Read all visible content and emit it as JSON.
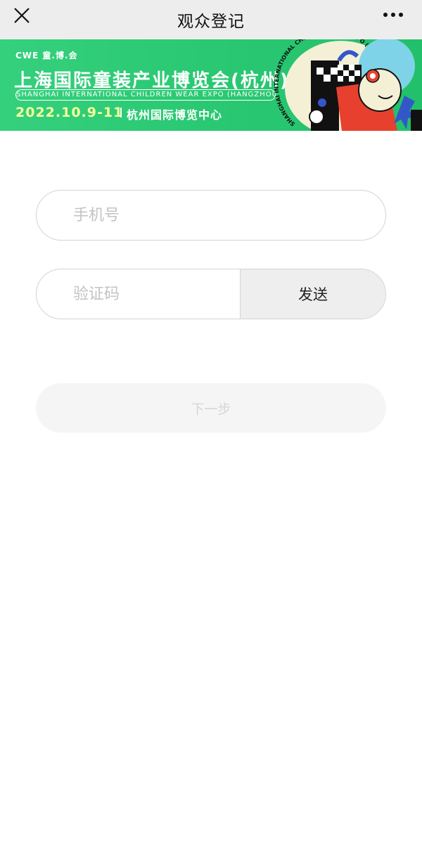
{
  "navbar": {
    "title": "观众登记",
    "close_icon": "close-icon",
    "more_icon": "more-icon"
  },
  "banner": {
    "logo_text": "CWE 童.博.会",
    "title": "上海国际童装产业博览会(杭州)",
    "subtitle": "SHANGHAI INTERNATIONAL CHILDREN WEAR EXPO (HANGZHOU)",
    "date": "2022.10.9-11",
    "venue": "杭州国际博览中心",
    "art_text": "SHANGHAI INTERNATIONAL CHILDREN WEAR EXPO (HANGZHOU)"
  },
  "form": {
    "phone_placeholder": "手机号",
    "code_placeholder": "验证码",
    "send_label": "发送",
    "next_label": "下一步"
  },
  "colors": {
    "banner_green": "#2ac872",
    "date_yellow": "#f4ff9a",
    "navbar_bg": "#ededed",
    "border": "#d4d4d4"
  }
}
